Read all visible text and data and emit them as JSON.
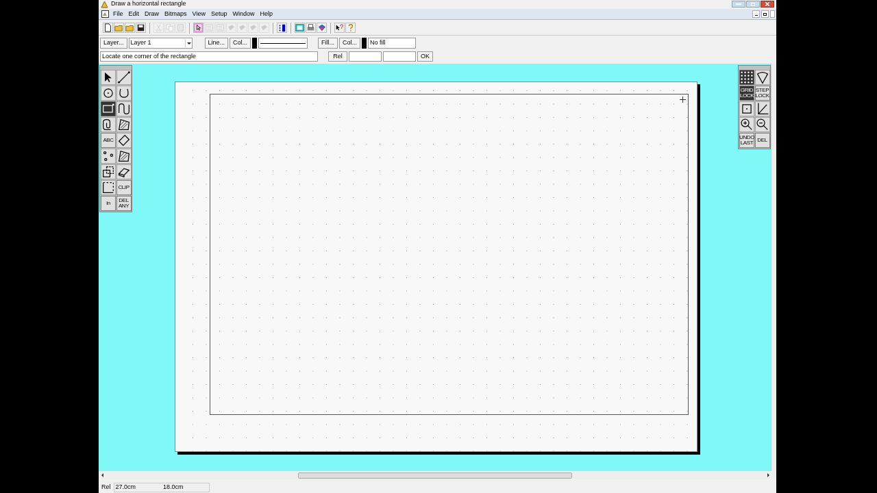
{
  "window": {
    "title": "Draw a horizontal rectangle"
  },
  "menu": [
    "File",
    "Edit",
    "Draw",
    "Bitmaps",
    "View",
    "Setup",
    "Window",
    "Help"
  ],
  "toolbar": [
    {
      "kind": "new",
      "disabled": false
    },
    {
      "kind": "open",
      "disabled": false
    },
    {
      "kind": "open",
      "disabled": false
    },
    {
      "kind": "save",
      "disabled": false
    },
    {
      "kind": "sep"
    },
    {
      "kind": "cut",
      "disabled": true
    },
    {
      "kind": "copy",
      "disabled": true
    },
    {
      "kind": "paste",
      "disabled": true
    },
    {
      "kind": "sep"
    },
    {
      "kind": "select",
      "disabled": false
    },
    {
      "kind": "list",
      "disabled": true
    },
    {
      "kind": "list",
      "disabled": true
    },
    {
      "kind": "layer",
      "disabled": true
    },
    {
      "kind": "layer",
      "disabled": true
    },
    {
      "kind": "layer",
      "disabled": true
    },
    {
      "kind": "layer",
      "disabled": true
    },
    {
      "kind": "sep"
    },
    {
      "kind": "bars",
      "disabled": false
    },
    {
      "kind": "sep"
    },
    {
      "kind": "screen",
      "disabled": false
    },
    {
      "kind": "print",
      "disabled": false
    },
    {
      "kind": "cube",
      "disabled": false
    },
    {
      "kind": "sep"
    },
    {
      "kind": "whatsthis",
      "disabled": false
    },
    {
      "kind": "help",
      "disabled": false
    }
  ],
  "properties": {
    "layer_button": "Layer...",
    "layer_select": "Layer 1",
    "line_button": "Line...",
    "line_color_button": "Col...",
    "fill_button": "Fill...",
    "fill_color_button": "Col...",
    "fill_value": "No fill"
  },
  "prompt": {
    "text": "Locate one corner of the rectangle",
    "rel_button": "Rel",
    "ok_button": "OK"
  },
  "left_tools": [
    {
      "kind": "arrow",
      "selected": false
    },
    {
      "kind": "line",
      "selected": false
    },
    {
      "kind": "circle",
      "selected": false
    },
    {
      "kind": "arc",
      "selected": false
    },
    {
      "kind": "rect",
      "selected": true
    },
    {
      "kind": "curve",
      "selected": false
    },
    {
      "kind": "spiral",
      "selected": false
    },
    {
      "kind": "hatch",
      "selected": false
    },
    {
      "kind": "text",
      "label": "ABC",
      "selected": false
    },
    {
      "kind": "tag",
      "selected": false
    },
    {
      "kind": "points",
      "selected": false
    },
    {
      "kind": "hatch",
      "selected": false
    },
    {
      "kind": "squares",
      "selected": false
    },
    {
      "kind": "eraser",
      "selected": false
    },
    {
      "kind": "corner",
      "selected": false
    },
    {
      "kind": "text",
      "label": "CLIP",
      "selected": false
    },
    {
      "kind": "text",
      "label": "in",
      "selected": false
    },
    {
      "kind": "text",
      "label": "DEL ANY",
      "selected": false
    }
  ],
  "right_tools": [
    {
      "kind": "grid",
      "selected": true
    },
    {
      "kind": "fan",
      "selected": false
    },
    {
      "kind": "text",
      "label": "GRID LOCK",
      "selected": true
    },
    {
      "kind": "text",
      "label": "STEP LOCK",
      "selected": false
    },
    {
      "kind": "square",
      "selected": false
    },
    {
      "kind": "axes",
      "selected": false
    },
    {
      "kind": "zoomin",
      "selected": false
    },
    {
      "kind": "zoomout",
      "selected": false
    },
    {
      "kind": "text",
      "label": "UNDO LAST",
      "selected": false
    },
    {
      "kind": "text",
      "label": "DEL",
      "selected": false
    }
  ],
  "status_bar": {
    "label": "Rel",
    "x": "27.0cm",
    "y": "18.0cm"
  }
}
